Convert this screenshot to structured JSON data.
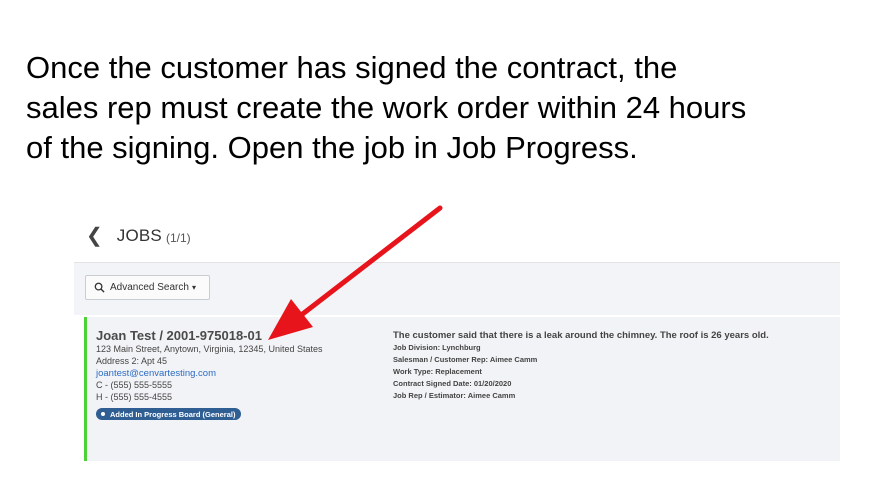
{
  "instructions": {
    "line1": "Once the customer has signed the contract, the",
    "line2": "sales rep must create the work order within 24 hours",
    "line3": "of the signing. Open the job in Job Progress."
  },
  "jobs_header": {
    "back_icon": "chevron-left-icon",
    "title": "JOBS",
    "count": "(1/1)"
  },
  "search": {
    "icon": "search-icon",
    "label": "Advanced Search",
    "caret": "▾"
  },
  "job": {
    "name": "Joan Test / 2001-975018-01",
    "address": "123 Main Street, Anytown, Virginia, 12345, United States",
    "address2": "Address 2: Apt 45",
    "email": "joantest@cenvartesting.com",
    "cell": "C - (555) 555-5555",
    "home": "H - (555) 555-4555",
    "status": "Added In Progress Board (General)",
    "description": "The customer said that there is a leak around the chimney. The roof is 26 years old.",
    "division": "Job Division:  Lynchburg",
    "salesman": "Salesman / Customer Rep:  Aimee Camm",
    "work_type": "Work Type:  Replacement",
    "contract_date": "Contract Signed Date:  01/20/2020",
    "job_rep": "Job Rep / Estimator:  Aimee Camm"
  },
  "colors": {
    "arrow": "#e8141b",
    "card_accent": "#4cd137",
    "badge": "#2f5e93",
    "email_link": "#2b6cc4"
  }
}
